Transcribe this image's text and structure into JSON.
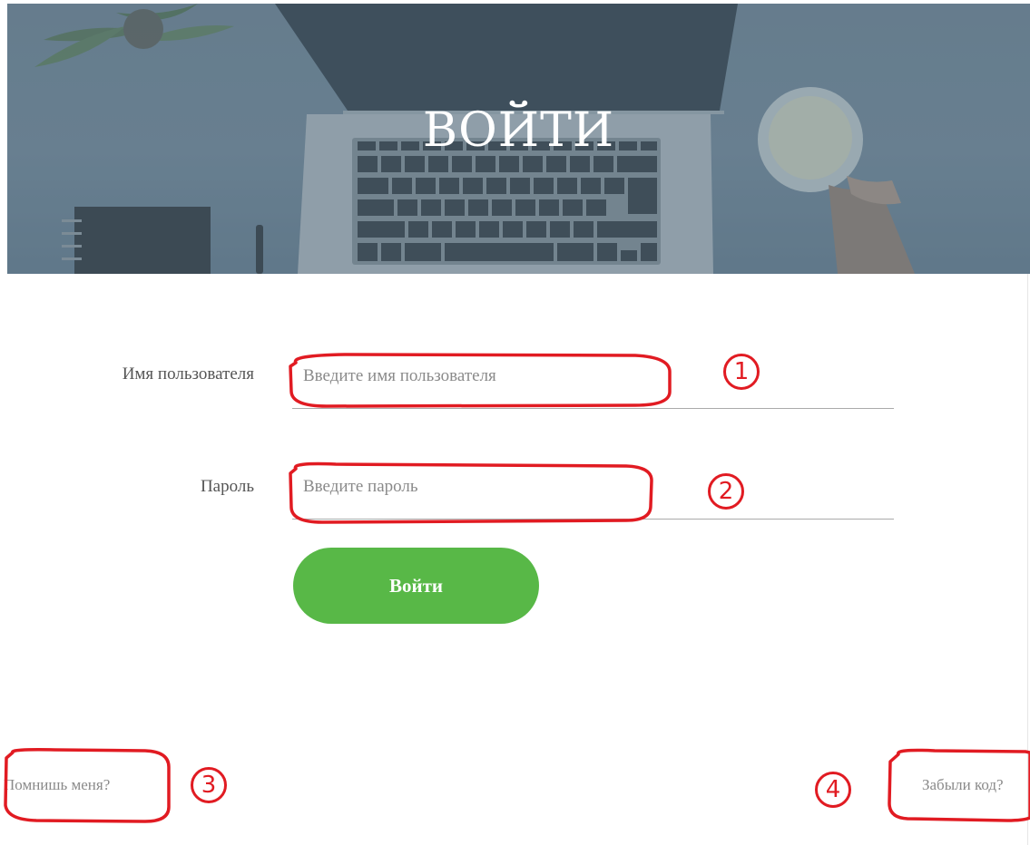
{
  "hero": {
    "title": "ВОЙТИ"
  },
  "form": {
    "username": {
      "label": "Имя пользователя",
      "placeholder": "Введите имя пользователя",
      "value": ""
    },
    "password": {
      "label": "Пароль",
      "placeholder": "Введите пароль",
      "value": ""
    },
    "submit_label": "Войти"
  },
  "footer": {
    "remember_me": "Помнишь меня?",
    "forgot_code": "Забыли код?"
  },
  "annotations": [
    "1",
    "2",
    "3",
    "4"
  ],
  "colors": {
    "accent": "#58b847",
    "annotation": "#e11b22",
    "hero_overlay": "#6d8394"
  }
}
